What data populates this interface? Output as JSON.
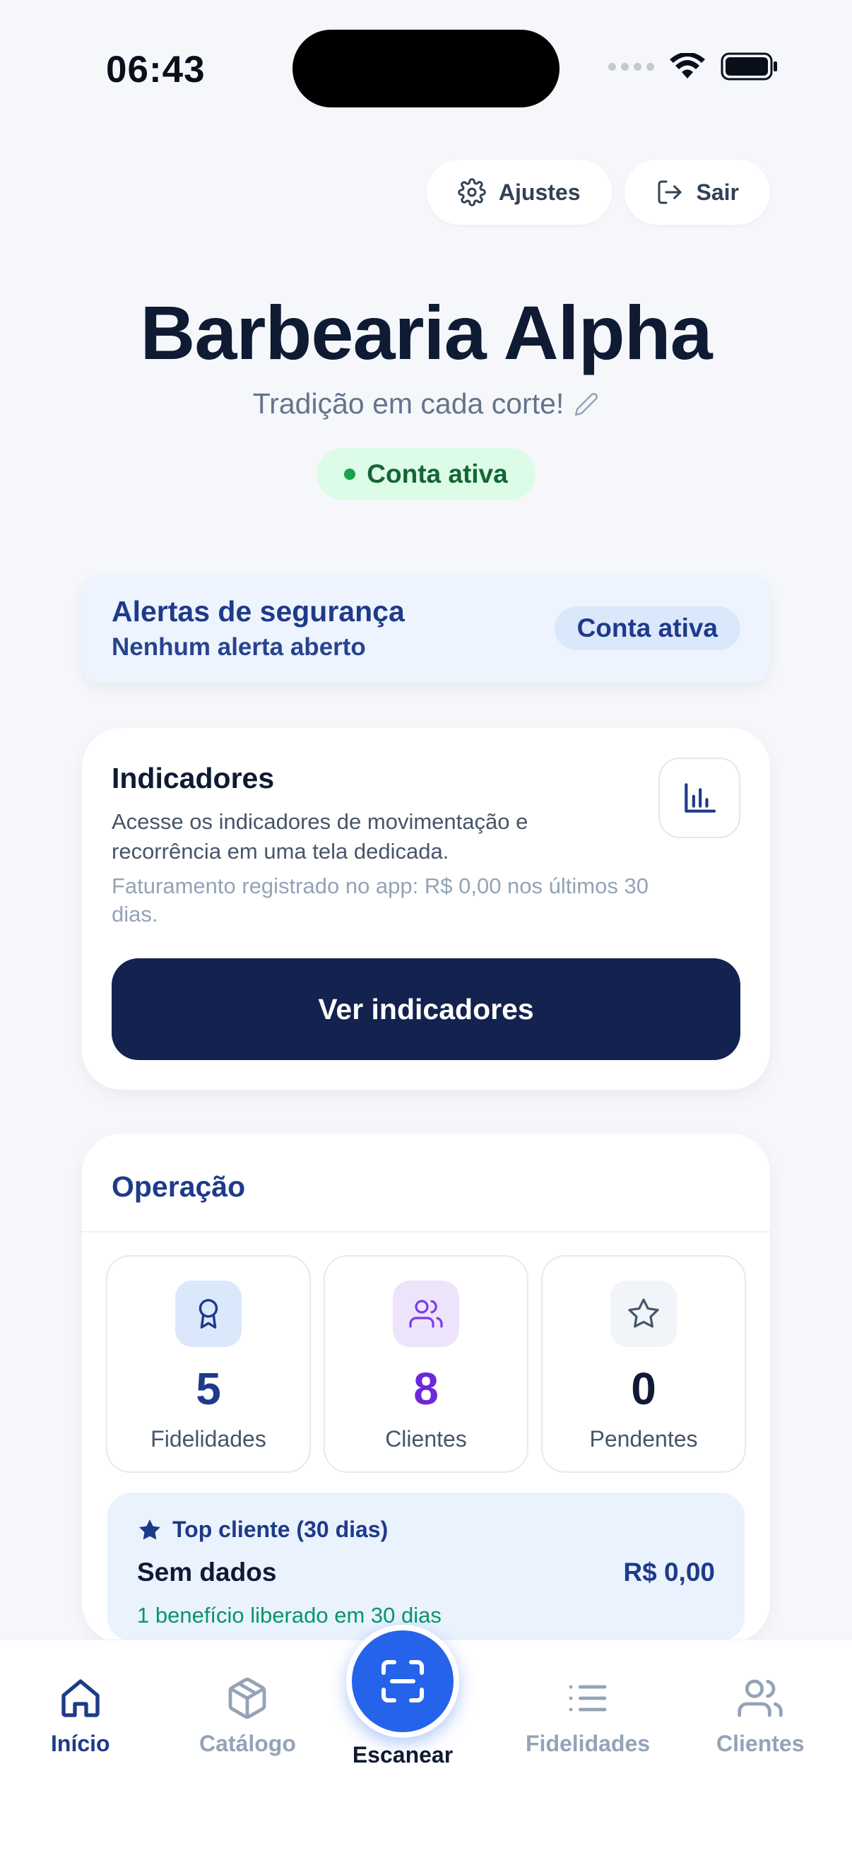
{
  "status_bar": {
    "time": "06:43"
  },
  "top_actions": {
    "settings_label": "Ajustes",
    "logout_label": "Sair"
  },
  "header": {
    "title": "Barbearia Alpha",
    "subtitle": "Tradição em cada corte!",
    "status": "Conta ativa"
  },
  "alerts": {
    "title": "Alertas de segurança",
    "subtitle": "Nenhum alerta aberto",
    "badge": "Conta ativa"
  },
  "indicators": {
    "title": "Indicadores",
    "description": "Acesse os indicadores de movimentação e recorrência em uma tela dedicada.",
    "note": "Faturamento registrado no app: R$ 0,00 nos últimos 30 dias.",
    "button_label": "Ver indicadores"
  },
  "operation": {
    "title": "Operação",
    "stats": [
      {
        "value": "5",
        "label": "Fidelidades",
        "icon": "award-icon",
        "color": "#1e3a8a",
        "bg": "#dbe8fc"
      },
      {
        "value": "8",
        "label": "Clientes",
        "icon": "users-icon",
        "color": "#6d28d9",
        "bg": "#ede4fc"
      },
      {
        "value": "0",
        "label": "Pendentes",
        "icon": "star-icon",
        "color": "#0f1a33",
        "bg": "#f1f4f8"
      }
    ],
    "top_client": {
      "heading": "Top cliente (30 dias)",
      "name": "Sem dados",
      "amount": "R$ 0,00",
      "benefit": "1 benefício liberado em 30 dias"
    }
  },
  "nav": {
    "home": "Início",
    "catalog": "Catálogo",
    "scan": "Escanear",
    "loyalty": "Fidelidades",
    "clients": "Clientes"
  }
}
